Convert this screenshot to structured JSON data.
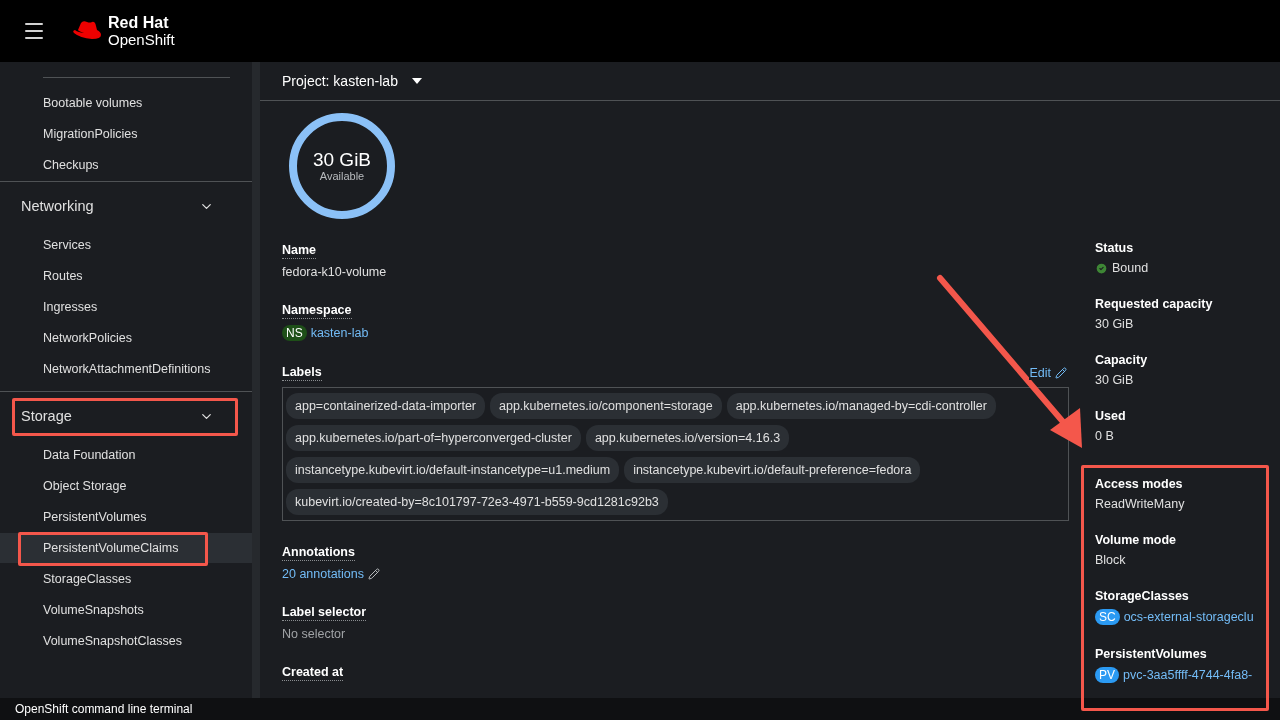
{
  "masthead": {
    "brand_line1": "Red Hat",
    "brand_line2": "OpenShift"
  },
  "sidebar": {
    "items": [
      {
        "kind": "link",
        "label": "Bootable volumes",
        "selected": false,
        "highlighted": false
      },
      {
        "kind": "link",
        "label": "MigrationPolicies",
        "selected": false,
        "highlighted": false
      },
      {
        "kind": "link",
        "label": "Checkups",
        "selected": false,
        "highlighted": false
      },
      {
        "kind": "group",
        "label": "Networking",
        "expanded": true,
        "highlighted": false,
        "children": [
          {
            "label": "Services",
            "selected": false,
            "highlighted": false
          },
          {
            "label": "Routes",
            "selected": false,
            "highlighted": false
          },
          {
            "label": "Ingresses",
            "selected": false,
            "highlighted": false
          },
          {
            "label": "NetworkPolicies",
            "selected": false,
            "highlighted": false
          },
          {
            "label": "NetworkAttachmentDefinitions",
            "selected": false,
            "highlighted": false
          }
        ]
      },
      {
        "kind": "group",
        "label": "Storage",
        "expanded": true,
        "highlighted": true,
        "children": [
          {
            "label": "Data Foundation",
            "selected": false,
            "highlighted": false
          },
          {
            "label": "Object Storage",
            "selected": false,
            "highlighted": false
          },
          {
            "label": "PersistentVolumes",
            "selected": false,
            "highlighted": false
          },
          {
            "label": "PersistentVolumeClaims",
            "selected": true,
            "highlighted": true
          },
          {
            "label": "StorageClasses",
            "selected": false,
            "highlighted": false
          },
          {
            "label": "VolumeSnapshots",
            "selected": false,
            "highlighted": false
          },
          {
            "label": "VolumeSnapshotClasses",
            "selected": false,
            "highlighted": false
          }
        ]
      }
    ]
  },
  "project_bar": {
    "label": "Project: kasten-lab"
  },
  "gauge": {
    "value": "30 GiB",
    "caption": "Available"
  },
  "left_details": [
    {
      "kind": "text",
      "label": "Name",
      "value": "fedora-k10-volume"
    },
    {
      "kind": "resource",
      "label": "Namespace",
      "badge": "NS",
      "color": "#1e4f18",
      "value": "kasten-lab"
    },
    {
      "kind": "labels",
      "label": "Labels",
      "edit": "Edit",
      "values": [
        "app=containerized-data-importer",
        "app.kubernetes.io/component=storage",
        "app.kubernetes.io/managed-by=cdi-controller",
        "app.kubernetes.io/part-of=hyperconverged-cluster",
        "app.kubernetes.io/version=4.16.3",
        "instancetype.kubevirt.io/default-instancetype=u1.medium",
        "instancetype.kubevirt.io/default-preference=fedora",
        "kubevirt.io/created-by=8c101797-72e3-4971-b559-9cd1281c92b3"
      ]
    },
    {
      "kind": "editlink",
      "label": "Annotations",
      "value": "20 annotations"
    },
    {
      "kind": "muted",
      "label": "Label selector",
      "value": "No selector"
    },
    {
      "kind": "text",
      "label": "Created at"
    }
  ],
  "right_details": [
    {
      "kind": "status",
      "label": "Status",
      "value": "Bound"
    },
    {
      "kind": "text",
      "label": "Requested capacity",
      "value": "30 GiB"
    },
    {
      "kind": "text",
      "label": "Capacity",
      "value": "30 GiB"
    },
    {
      "kind": "text",
      "label": "Used",
      "value": "0 B"
    }
  ],
  "highlighted_details": [
    {
      "kind": "text",
      "label": "Access modes",
      "value": "ReadWriteMany"
    },
    {
      "kind": "text",
      "label": "Volume mode",
      "value": "Block"
    },
    {
      "kind": "resource",
      "label": "StorageClasses",
      "badge": "SC",
      "color": "#2b9af3",
      "value": "ocs-external-storageclu"
    },
    {
      "kind": "resource",
      "label": "PersistentVolumes",
      "badge": "PV",
      "color": "#2b9af3",
      "value": "pvc-3aa5ffff-4744-4fa8-"
    }
  ],
  "terminal_bar": {
    "label": "OpenShift command line terminal"
  }
}
